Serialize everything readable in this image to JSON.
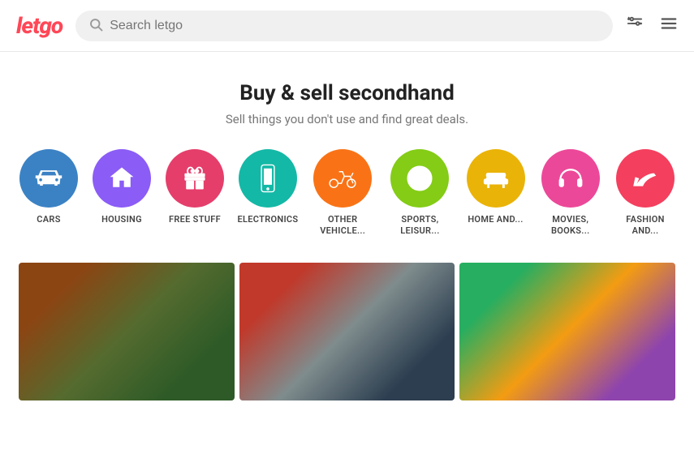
{
  "header": {
    "logo": "letgo",
    "search_placeholder": "Search letgo"
  },
  "hero": {
    "title": "Buy & sell secondhand",
    "subtitle": "Sell things you don't use and find great deals."
  },
  "categories": [
    {
      "id": "cars",
      "label": "CARS",
      "color": "#3b82c4",
      "icon": "car"
    },
    {
      "id": "housing",
      "label": "HOUSING",
      "color": "#8b5cf6",
      "icon": "house"
    },
    {
      "id": "free-stuff",
      "label": "FREE STUFF",
      "color": "#e53e6b",
      "icon": "gift"
    },
    {
      "id": "electronics",
      "label": "ELECTRONICS",
      "color": "#14b8a6",
      "icon": "phone"
    },
    {
      "id": "other-vehicles",
      "label": "OTHER VEHICLE...",
      "color": "#f97316",
      "icon": "scooter"
    },
    {
      "id": "sports",
      "label": "SPORTS, LEISUR...",
      "color": "#84cc16",
      "icon": "basketball"
    },
    {
      "id": "home-and",
      "label": "HOME AND...",
      "color": "#eab308",
      "icon": "sofa"
    },
    {
      "id": "movies-books",
      "label": "MOVIES, BOOKS...",
      "color": "#ec4899",
      "icon": "headphones"
    },
    {
      "id": "fashion",
      "label": "FASHION AND...",
      "color": "#f43f5e",
      "icon": "heel"
    }
  ],
  "products": [
    {
      "id": "lawnmower",
      "type": "lawnmower"
    },
    {
      "id": "tools",
      "type": "tools"
    },
    {
      "id": "tiles",
      "type": "tiles"
    }
  ]
}
